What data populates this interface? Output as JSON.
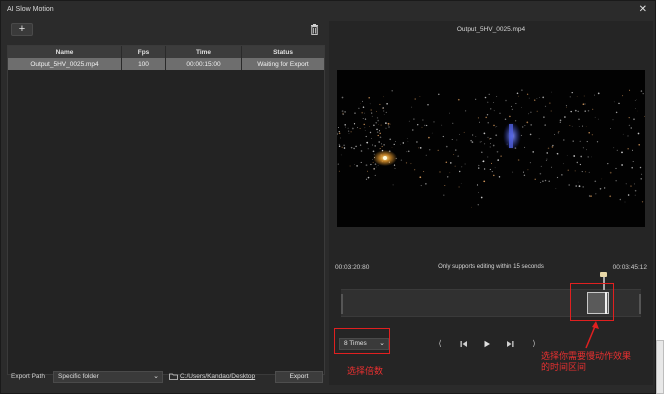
{
  "window": {
    "title": "AI Slow Motion"
  },
  "left": {
    "add_label": "+",
    "columns": [
      "Name",
      "Fps",
      "Time",
      "Status"
    ],
    "rows": [
      {
        "name": "Output_5HV_0025.mp4",
        "fps": "100",
        "time": "00:00:15:00",
        "status": "Waiting for Export"
      }
    ]
  },
  "bottom": {
    "export_path_label": "Export Path",
    "path_option": "Specific folder",
    "path": "C:/Users/Kandao/Desktop",
    "export_label": "Export"
  },
  "preview": {
    "filename": "Output_5HV_0025.mp4",
    "time_start": "00:03:20:80",
    "time_end": "00:03:45:12",
    "edit_note": "Only supports editing within 15 seconds"
  },
  "controls": {
    "speed_value": "8 Times"
  },
  "annotations": {
    "speed_note": "选择倍数",
    "range_note": "选择你需要慢动作效果的时间区间"
  },
  "colors": {
    "annotation": "#e02020",
    "selected_row": "#6e6e6e",
    "background": "#2b2b2b"
  },
  "icons": [
    "close-icon",
    "trash-icon",
    "folder-icon",
    "chevron-down-icon",
    "skip-back-icon",
    "play-icon",
    "skip-forward-icon"
  ]
}
